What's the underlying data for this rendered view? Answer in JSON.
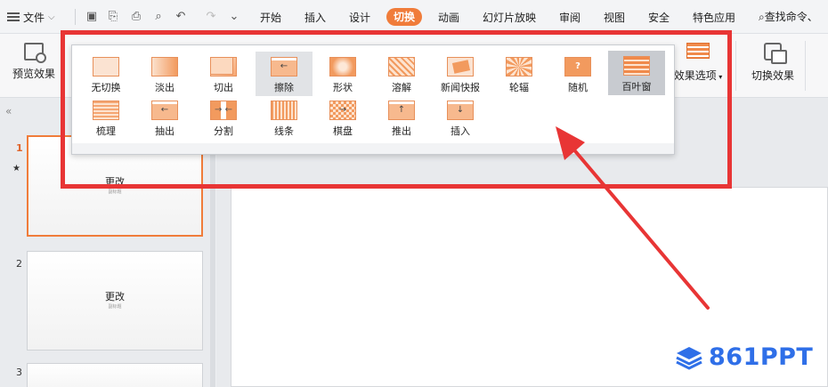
{
  "menu": {
    "file_label": "文件",
    "tabs": [
      "开始",
      "插入",
      "设计",
      "切换",
      "动画",
      "幻灯片放映",
      "审阅",
      "视图",
      "安全",
      "特色应用"
    ],
    "active_tab": "切换",
    "search_label": "查找命令、"
  },
  "ribbon": {
    "preview_label": "预览效果",
    "effect_options_label": "效果选项",
    "switch_effect_label": "切换效果"
  },
  "gallery": {
    "row1": [
      {
        "label": "无切换",
        "icon": "no-transition-icon"
      },
      {
        "label": "淡出",
        "icon": "fade-icon"
      },
      {
        "label": "切出",
        "icon": "cut-icon"
      },
      {
        "label": "擦除",
        "icon": "wipe-icon"
      },
      {
        "label": "形状",
        "icon": "shape-icon"
      },
      {
        "label": "溶解",
        "icon": "dissolve-icon"
      },
      {
        "label": "新闻快报",
        "icon": "newsflash-icon"
      },
      {
        "label": "轮辐",
        "icon": "wheel-icon"
      },
      {
        "label": "随机",
        "icon": "random-icon",
        "glyph": "?"
      },
      {
        "label": "百叶窗",
        "icon": "blinds-icon"
      }
    ],
    "row2": [
      {
        "label": "梳理",
        "icon": "comb-icon"
      },
      {
        "label": "抽出",
        "icon": "pull-icon",
        "glyph": "←"
      },
      {
        "label": "分割",
        "icon": "split-icon",
        "glyph": "→ ←"
      },
      {
        "label": "线条",
        "icon": "lines-icon"
      },
      {
        "label": "棋盘",
        "icon": "checkerboard-icon",
        "glyph": "→"
      },
      {
        "label": "推出",
        "icon": "push-icon",
        "glyph": "↑"
      },
      {
        "label": "插入",
        "icon": "cover-icon",
        "glyph": "↓"
      }
    ],
    "hovered": "擦除",
    "selected": "百叶窗"
  },
  "slides": [
    {
      "number": "1",
      "title": "更改",
      "subtitle": "副标题",
      "selected": true,
      "has_animation": true
    },
    {
      "number": "2",
      "title": "更改",
      "subtitle": "副标题",
      "selected": false,
      "has_animation": false
    },
    {
      "number": "3",
      "title": "",
      "subtitle": "",
      "selected": false,
      "has_animation": false
    }
  ],
  "watermark": {
    "text": "861PPT"
  },
  "colors": {
    "accent": "#f07c3a",
    "highlight_red": "#e83535",
    "watermark_blue": "#2f6fe8"
  }
}
